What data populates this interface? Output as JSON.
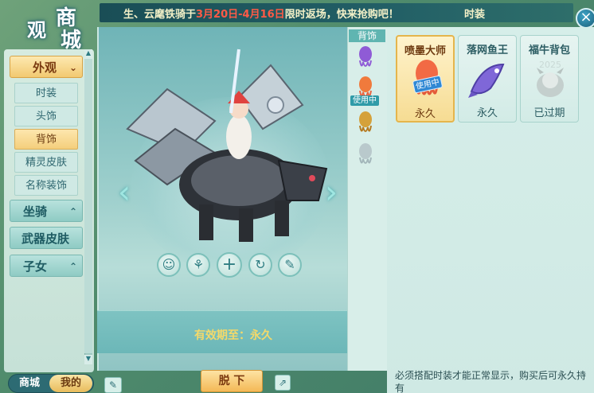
{
  "app": {
    "title_chars": [
      "商",
      "城"
    ],
    "title_chars_2": [
      "观"
    ]
  },
  "marquee": {
    "part1": "生、云麾铁骑于",
    "date_range": "3月20日-4月16日",
    "part2": "限时返场，快来抢购吧！",
    "tail": "时装"
  },
  "sidebar": {
    "categories": [
      {
        "label": "外观",
        "active": true
      },
      {
        "label": "坐骑",
        "active": false
      },
      {
        "label": "武器皮肤",
        "active": false
      },
      {
        "label": "子女",
        "active": false
      }
    ],
    "sub_items": [
      {
        "label": "时装",
        "active": false
      },
      {
        "label": "头饰",
        "active": false
      },
      {
        "label": "背饰",
        "active": true
      },
      {
        "label": "精灵皮肤",
        "active": false
      },
      {
        "label": "名称装饰",
        "active": false
      }
    ]
  },
  "bottom_tabs": {
    "shop": "商城",
    "mine": "我的",
    "selected": "我的"
  },
  "preview": {
    "expiry_label": "有效期至：",
    "expiry_value": "永久",
    "takeoff_button": "脱 下"
  },
  "strip": {
    "label": "背饰",
    "in_use_badge": "使用中"
  },
  "items": [
    {
      "name": "喷墨大师",
      "duration": "永久",
      "selected": true,
      "in_use_tag": "使用中"
    },
    {
      "name": "落网鱼王",
      "duration": "永久",
      "selected": false
    },
    {
      "name": "福牛背包",
      "duration": "已过期",
      "selected": false,
      "year_mark": "2025"
    }
  ],
  "note": "必须搭配时装才能正常显示，购买后可永久持有",
  "icons": {
    "close": "close-icon",
    "arrow_left": "chevron-left-icon",
    "arrow_right": "chevron-right-icon",
    "actions": [
      "character-icon",
      "pose-icon",
      "plus-icon",
      "rotate-icon",
      "brush-icon"
    ],
    "edit": "edit-icon",
    "share": "share-icon"
  },
  "colors": {
    "accent_gold": "#f4b957",
    "marquee_red": "#ff5a46",
    "panel_teal": "#d6eee9"
  }
}
